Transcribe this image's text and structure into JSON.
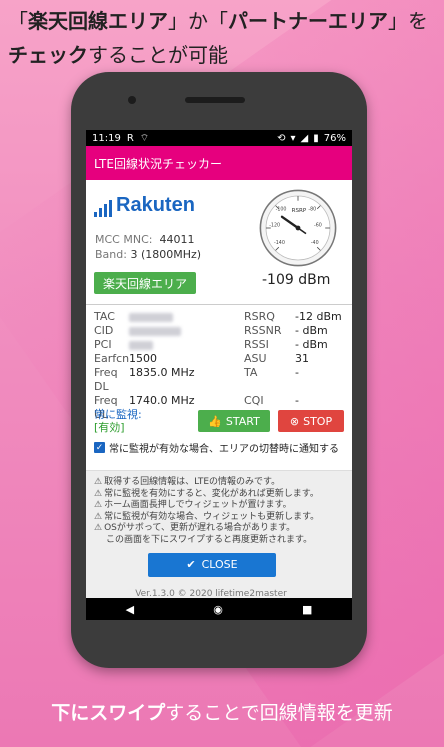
{
  "headline": {
    "q1": "「",
    "rakuten_area": "楽天回線エリア",
    "q2": "」か「",
    "partner_area": "パートナーエリア",
    "q3": "」を",
    "check": "チェック",
    "rest": "することが可能"
  },
  "footer": {
    "bold": "下にスワイプ",
    "rest": "することで回線情報を更新"
  },
  "status_bar": {
    "time": "11:19",
    "battery": "76%"
  },
  "app": {
    "title": "LTE回線状況チェッカー",
    "brand": "Rakuten",
    "mcc_label": "MCC MNC:",
    "mcc_value": "44011",
    "band_label": "Band:",
    "band_value": "3 (1800MHz)",
    "area_badge": "楽天回線エリア",
    "gauge_label": "RSRP",
    "gauge_ticks": [
      "-140",
      "-120",
      "-100",
      "-80",
      "-60",
      "-40"
    ],
    "rsrp_value": "-109 dBm"
  },
  "metrics": {
    "left": [
      {
        "k": "TAC",
        "v": ""
      },
      {
        "k": "CID",
        "v": ""
      },
      {
        "k": "PCI",
        "v": ""
      },
      {
        "k": "Earfcn",
        "v": "1500"
      },
      {
        "k": "Freq DL",
        "v": "1835.0 MHz"
      },
      {
        "k": "Freq UL",
        "v": "1740.0 MHz"
      }
    ],
    "right": [
      {
        "k": "RSRQ",
        "v": "-12 dBm"
      },
      {
        "k": "RSSNR",
        "v": "- dBm"
      },
      {
        "k": "RSSI",
        "v": "- dBm"
      },
      {
        "k": "ASU",
        "v": "31"
      },
      {
        "k": "TA",
        "v": "-"
      },
      {
        "k": "CQI",
        "v": "-"
      }
    ]
  },
  "monitor": {
    "label": "常に監視:",
    "state": "[有効]",
    "start": "START",
    "stop": "STOP",
    "notify": "常に監視が有効な場合、エリアの切替時に通知する"
  },
  "notes": [
    "取得する回線情報は、LTEの情報のみです。",
    "常に監視を有効にすると、変化があれば更新します。",
    "ホーム画面長押しでウィジェットが置けます。",
    "常に監視が有効な場合、ウィジェットも更新します。",
    "OSがサボって、更新が遅れる場合があります。",
    "この画面を下にスワイプすると再度更新されます。"
  ],
  "close": "CLOSE",
  "version": "Ver.1.3.0 © 2020 lifetime2master",
  "colors": {
    "accent": "#e6007e",
    "brand": "#1a66c1",
    "green": "#4cae4c",
    "red": "#e0453f",
    "blue": "#1976d2"
  }
}
